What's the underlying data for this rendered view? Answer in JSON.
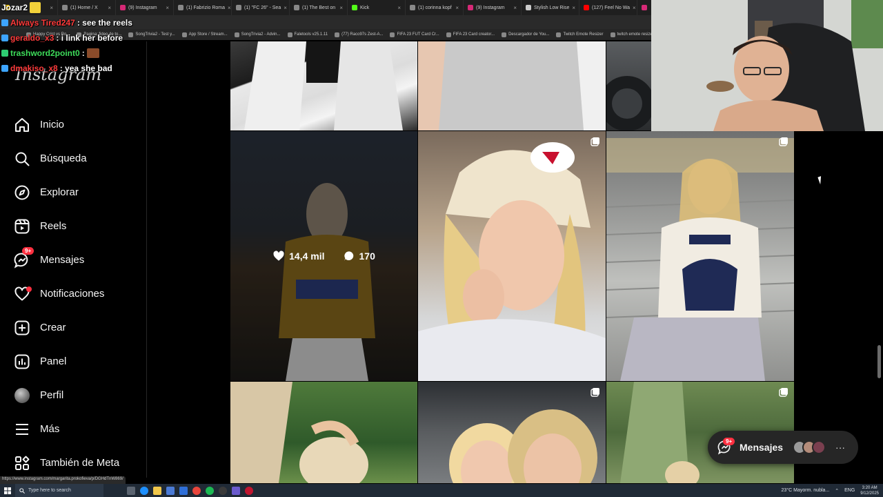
{
  "browser": {
    "tabs": [
      {
        "label": "",
        "color": "#e6b800"
      },
      {
        "label": "(1) Home / X",
        "color": "#888888"
      },
      {
        "label": "(9) Instagram",
        "color": "#d62976"
      },
      {
        "label": "(1) Fabrizio Roma",
        "color": "#888888"
      },
      {
        "label": "(1) \"FC 26\" - Sea",
        "color": "#888888"
      },
      {
        "label": "(1) The Best on",
        "color": "#888888"
      },
      {
        "label": "Kick",
        "color": "#53fc18"
      },
      {
        "label": "(1) corinna kopf",
        "color": "#888888"
      },
      {
        "label": "(9) Instagram",
        "color": "#d62976"
      },
      {
        "label": "Stylish Low Rise",
        "color": "#cccccc"
      },
      {
        "label": "(127) Feel No Wa",
        "color": "#ff0000"
      },
      {
        "label": "",
        "color": "#d62976"
      }
    ],
    "bookmarks": [
      "Happy Crist vs Ro...",
      "Pagina: fideo de to...",
      "SongTrivia2 - Test y...",
      "App Store / Stream...",
      "SongTrivia2 - Advin...",
      "Faletools v25.1.11",
      "(77) Raco97s Zest-A...",
      "FIFA 23 FUT Card Cr...",
      "FIFA 23 Card creator...",
      "Descargador de You...",
      "Twitch Emote Resizer",
      "twitch emote resizer..."
    ],
    "status_url": "https://www.instagram.com/margarita.prokofieva/p/DGHdTnW869/"
  },
  "chat": {
    "top_user": "Jozar2",
    "messages": [
      {
        "user": "Always Tired247",
        "user_color": "#ff3b3b",
        "text": ": see the reels"
      },
      {
        "user": "geraldo_x3",
        "user_color": "#ff3b3b",
        "text": ": i link her before"
      },
      {
        "user": "trashword2point0",
        "user_color": "#3ddc5a",
        "text": " :"
      },
      {
        "user": "dmakiso_x8",
        "user_color": "#ff3b3b",
        "text": ": yea she bad"
      }
    ]
  },
  "sidebar": {
    "logo": "Instagram",
    "items": [
      {
        "label": "Inicio",
        "icon": "home-icon"
      },
      {
        "label": "Búsqueda",
        "icon": "search-icon"
      },
      {
        "label": "Explorar",
        "icon": "compass-icon"
      },
      {
        "label": "Reels",
        "icon": "reels-icon"
      },
      {
        "label": "Mensajes",
        "icon": "messenger-icon",
        "badge": "9+"
      },
      {
        "label": "Notificaciones",
        "icon": "heart-icon",
        "dot": true
      },
      {
        "label": "Crear",
        "icon": "plus-square-icon"
      },
      {
        "label": "Panel",
        "icon": "chart-icon"
      },
      {
        "label": "Perfil",
        "icon": "avatar"
      },
      {
        "label": "Más",
        "icon": "menu-icon"
      },
      {
        "label": "También de Meta",
        "icon": "meta-grid-icon"
      }
    ]
  },
  "grid": {
    "hover_post": {
      "likes": "14,4 mil",
      "comments": "170"
    }
  },
  "messages_pill": {
    "label": "Mensajes",
    "badge": "9+"
  },
  "taskbar": {
    "search_placeholder": "Type here to search",
    "weather": "23°C  Mayorm. nubla...",
    "lang": "ENG",
    "time": "3:20 AM",
    "date": "9/12/2025"
  },
  "colors": {
    "accent_red": "#ff3040",
    "panel_dark": "#262626"
  }
}
